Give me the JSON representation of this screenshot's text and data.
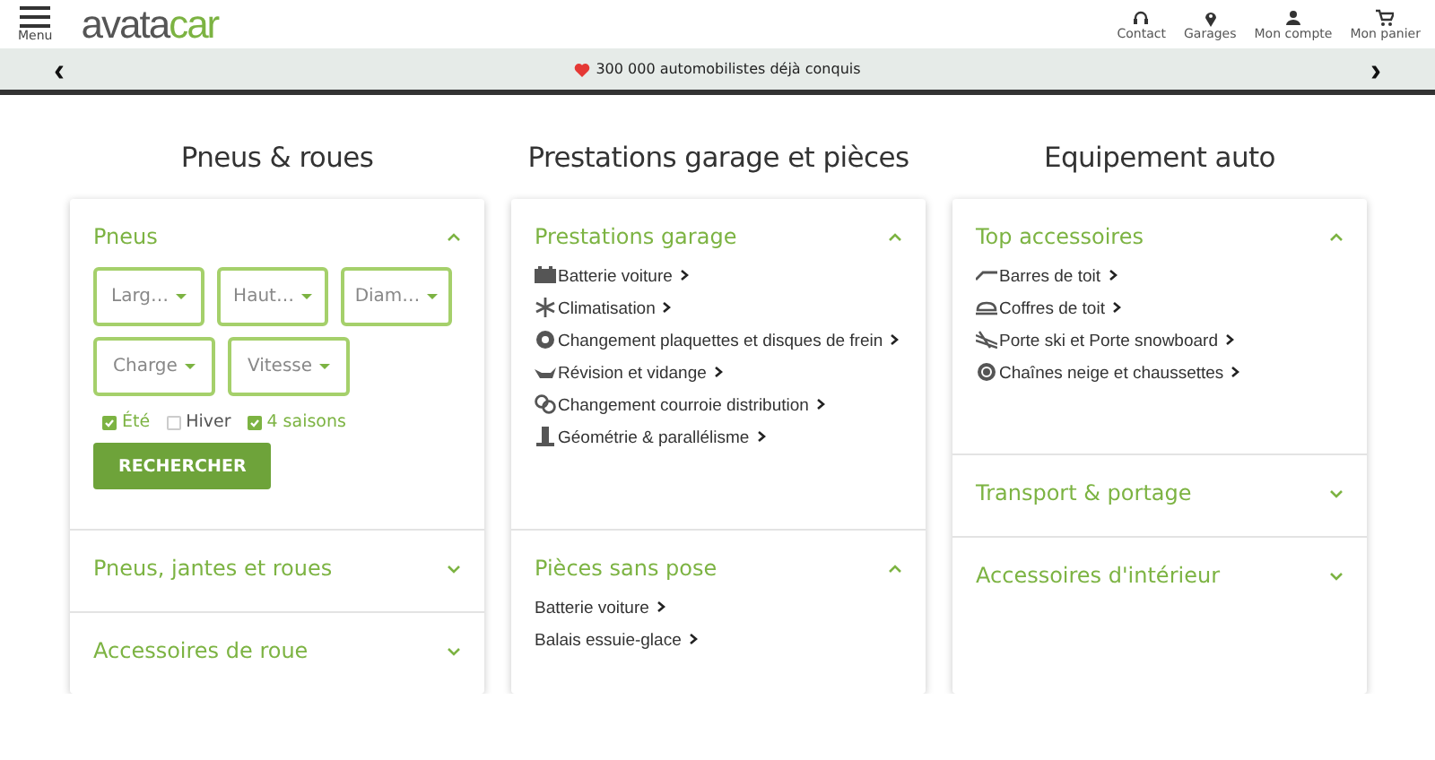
{
  "header": {
    "menu_label": "Menu",
    "logo": {
      "text": "avata",
      "accent": "car"
    },
    "nav": [
      {
        "label": "Contact",
        "kind": "headset"
      },
      {
        "label": "Garages",
        "kind": "pin"
      },
      {
        "label": "Mon compte",
        "kind": "person"
      },
      {
        "label": "Mon panier",
        "kind": "cart"
      }
    ]
  },
  "banner": {
    "prev": "‹",
    "text": "300 000 automobilistes déjà conquis",
    "next": "›"
  },
  "columns": [
    {
      "title": "Pneus & roues",
      "sections": [
        {
          "kind": "tyre_search",
          "title": "Pneus",
          "expanded": true,
          "selects": [
            {
              "label": "Larg…"
            },
            {
              "label": "Haut…"
            },
            {
              "label": "Diam…"
            },
            {
              "label": "Charge"
            },
            {
              "label": "Vitesse"
            }
          ],
          "seasons": [
            {
              "label": "Été",
              "checked": true
            },
            {
              "label": "Hiver",
              "checked": false
            },
            {
              "label": "4 saisons",
              "checked": true
            }
          ],
          "button": "RECHERCHER"
        },
        {
          "title": "Pneus, jantes et roues",
          "expanded": false
        },
        {
          "title": "Accessoires de roue",
          "expanded": false
        }
      ]
    },
    {
      "title": "Prestations garage et pièces",
      "sections": [
        {
          "kind": "links",
          "title": "Prestations garage",
          "expanded": true,
          "items": [
            {
              "label": "Batterie voiture",
              "kind": "battery"
            },
            {
              "label": "Climatisation",
              "kind": "snow"
            },
            {
              "label": "Changement plaquettes et disques de frein",
              "kind": "disc"
            },
            {
              "label": "Révision et vidange",
              "kind": "oil"
            },
            {
              "label": "Changement courroie distribution",
              "kind": "belt"
            },
            {
              "label": "Géométrie & parallélisme",
              "kind": "lift"
            }
          ]
        },
        {
          "kind": "links",
          "title": "Pièces sans pose",
          "expanded": true,
          "items": [
            {
              "label": "Batterie voiture"
            },
            {
              "label": "Balais essuie-glace"
            }
          ]
        }
      ]
    },
    {
      "title": "Equipement auto",
      "sections": [
        {
          "kind": "links",
          "title": "Top accessoires",
          "expanded": true,
          "items": [
            {
              "label": "Barres de toit",
              "kind": "bars"
            },
            {
              "label": "Coffres de toit",
              "kind": "box"
            },
            {
              "label": "Porte ski et Porte snowboard",
              "kind": "ski"
            },
            {
              "label": "Chaînes neige et chaussettes",
              "kind": "tyre"
            }
          ]
        },
        {
          "title": "Transport & portage",
          "expanded": false
        },
        {
          "title": "Accessoires d'intérieur",
          "expanded": false
        }
      ]
    }
  ]
}
